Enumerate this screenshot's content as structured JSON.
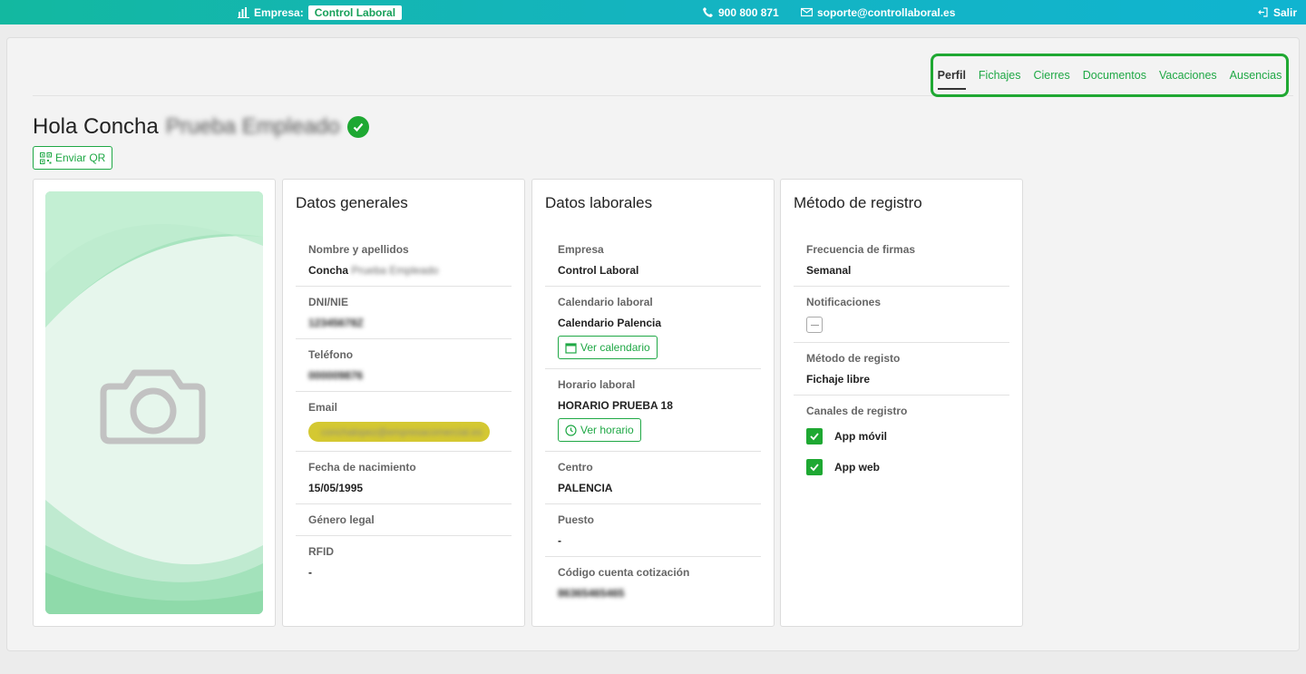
{
  "topbar": {
    "company_prefix": "Empresa:",
    "company_name": "Control Laboral",
    "phone": "900 800 871",
    "email": "soporte@controllaboral.es",
    "logout": "Salir"
  },
  "tabs": [
    {
      "label": "Perfil",
      "active": true
    },
    {
      "label": "Fichajes"
    },
    {
      "label": "Cierres"
    },
    {
      "label": "Documentos"
    },
    {
      "label": "Vacaciones"
    },
    {
      "label": "Ausencias"
    }
  ],
  "greeting": {
    "prefix": "Hola Concha",
    "redacted": "Prueba Empleado"
  },
  "qr_button": "Enviar QR",
  "general": {
    "title": "Datos generales",
    "name_label": "Nombre y apellidos",
    "name_first": "Concha",
    "name_redacted": "Prueba Empleado",
    "dni_label": "DNI/NIE",
    "dni_value": "12345678Z",
    "phone_label": "Teléfono",
    "phone_value": "000009876",
    "email_label": "Email",
    "email_value": "conchalopez@empresacomercial.es",
    "birth_label": "Fecha de nacimiento",
    "birth_value": "15/05/1995",
    "gender_label": "Género legal",
    "rfid_label": "RFID",
    "rfid_value": "-"
  },
  "labor": {
    "title": "Datos laborales",
    "company_label": "Empresa",
    "company_value": "Control Laboral",
    "calendar_label": "Calendario laboral",
    "calendar_value": "Calendario Palencia",
    "calendar_button": "Ver calendario",
    "schedule_label": "Horario laboral",
    "schedule_value": "HORARIO PRUEBA 18",
    "schedule_button": "Ver horario",
    "center_label": "Centro",
    "center_value": "PALENCIA",
    "position_label": "Puesto",
    "position_value": "-",
    "account_label": "Código cuenta cotización",
    "account_value": "86365465465"
  },
  "method": {
    "title": "Método de registro",
    "freq_label": "Frecuencia de firmas",
    "freq_value": "Semanal",
    "notif_label": "Notificaciones",
    "method_label": "Método de registo",
    "method_value": "Fichaje libre",
    "channels_label": "Canales de registro",
    "channels": [
      {
        "label": "App móvil",
        "checked": true
      },
      {
        "label": "App web",
        "checked": true
      }
    ]
  },
  "colors": {
    "accent_green": "#1fa845",
    "topbar_teal": "#14b4c0",
    "email_highlight": "#d4c832"
  }
}
